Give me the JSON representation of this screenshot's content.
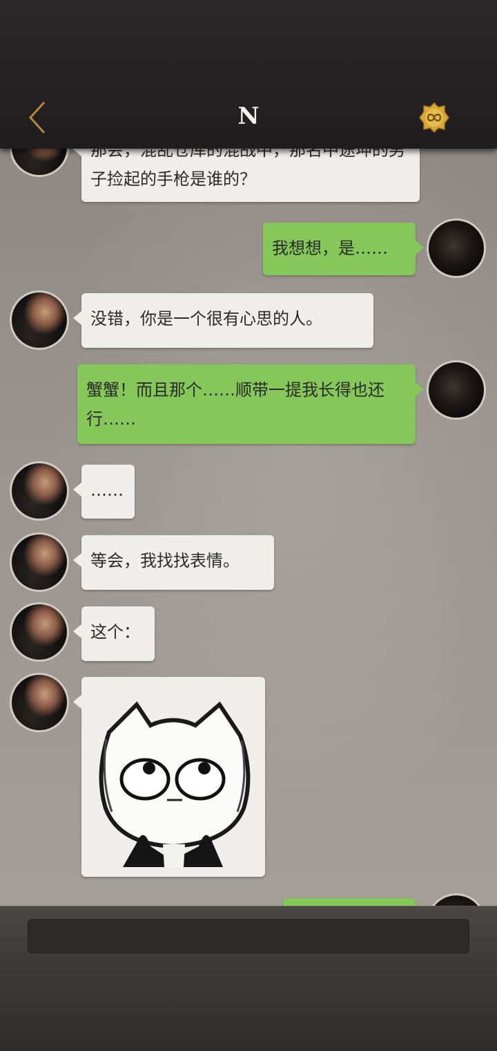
{
  "header": {
    "title": "N"
  },
  "messages": [
    {
      "side": "left",
      "text": "那会，混乱仓库的混战中，那名中途坤的男子捡起的手枪是谁的？"
    },
    {
      "side": "right",
      "text": "我想想，是……"
    },
    {
      "side": "left",
      "text": "没错，你是一个很有心思的人。"
    },
    {
      "side": "right",
      "text": "蟹蟹！而且那个……顺带一提我长得也还行……"
    },
    {
      "side": "left",
      "text": "……"
    },
    {
      "side": "left",
      "text": "等会，我找找表情。"
    },
    {
      "side": "left",
      "text": "这个："
    },
    {
      "side": "left",
      "type": "sticker",
      "sticker": "cat-rolling-eyes-sticker"
    }
  ],
  "icons": {
    "back": "chevron-left-icon",
    "infinity": "infinity-badge-icon"
  },
  "colors": {
    "accent_gold": "#d9a63a",
    "bubble_green": "#86c75a",
    "bubble_white": "#efeeea"
  }
}
